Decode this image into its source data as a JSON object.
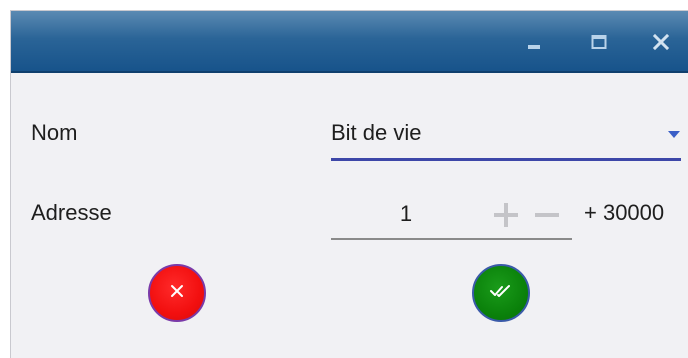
{
  "window": {
    "title_bar": {
      "buttons": [
        "minimize-icon",
        "maximize-icon",
        "close-icon"
      ]
    }
  },
  "form": {
    "nom": {
      "label": "Nom",
      "selected": "Bit de vie",
      "dropdown_icon": "chevron-down-icon"
    },
    "adresse": {
      "label": "Adresse",
      "value": "1",
      "increment_icon": "plus-icon",
      "decrement_icon": "minus-icon",
      "offset": "+ 30000"
    }
  },
  "actions": {
    "cancel_icon": "close-icon",
    "confirm_icon": "double-check-icon"
  },
  "colors": {
    "title_bar": "#16528a",
    "accent_underline": "#3d47a8",
    "cancel": "#f20f0f",
    "confirm": "#0b820b"
  }
}
